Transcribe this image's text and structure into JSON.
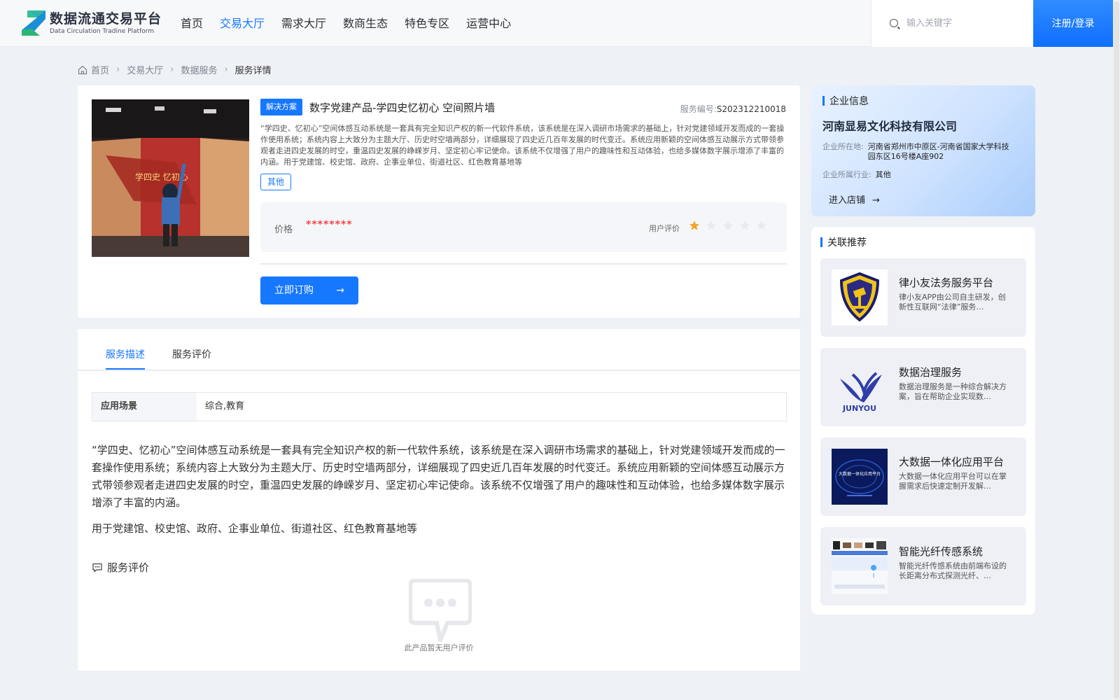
{
  "header": {
    "logo_title": "数据流通交易平台",
    "logo_subtitle": "Data Circulation Tradine Platform",
    "nav": [
      "首页",
      "交易大厅",
      "需求大厅",
      "数商生态",
      "特色专区",
      "运营中心"
    ],
    "nav_active_index": 1,
    "search_placeholder": "输入关键字",
    "login_label": "注册/登录"
  },
  "breadcrumb": [
    "首页",
    "交易大厅",
    "数据服务",
    "服务详情"
  ],
  "product": {
    "badge": "解决方案",
    "title": "数字党建产品-学四史忆初心 空间照片墙",
    "service_no_label": "服务编号:",
    "service_no": "S202312210018",
    "description": "“学四史、忆初心”空间体感互动系统是一套具有完全知识产权的新一代软件系统，该系统是在深入调研市场需求的基础上，针对党建领域开发而成的一套操作使用系统；系统内容上大致分为主题大厅、历史时空墙两部分，详细展现了四史近几百年发展的时代变迁。系统应用新颖的空间体感互动展示方式带领参观者走进四史发展的时空，重温四史发展的峥嵘岁月、坚定初心牢记使命。该系统不仅增强了用户的趣味性和互动体验，也给多媒体数字展示增添了丰富的内涵。用于党建馆、校史馆、政府、企事业单位、街道社区、红色教育基地等",
    "tag": "其他",
    "price_label": "价格",
    "price_value": "********",
    "rating_label": "用户评价",
    "rating": 1,
    "rating_max": 5,
    "order_label": "立即订购",
    "image_text": "学四史 忆初心"
  },
  "tabs": {
    "items": [
      "服务描述",
      "服务评价"
    ],
    "active_index": 0
  },
  "detail": {
    "scene_label": "应用场景",
    "scene_value": "综合,教育",
    "paragraph1": "“学四史、忆初心”空间体感互动系统是一套具有完全知识产权的新一代软件系统，该系统是在深入调研市场需求的基础上，针对党建领域开发而成的一套操作使用系统；系统内容上大致分为主题大厅、历史时空墙两部分，详细展现了四史近几百年发展的时代变迁。系统应用新颖的空间体感互动展示方式带领参观者走进四史发展的时空，重温四史发展的峥嵘岁月、坚定初心牢记使命。该系统不仅增强了用户的趣味性和互动体验，也给多媒体数字展示增添了丰富的内涵。",
    "paragraph2": "用于党建馆、校史馆、政府、企事业单位、街道社区、红色教育基地等",
    "review_title": "服务评价",
    "empty_text": "此产品暂无用户评价"
  },
  "company": {
    "section_title": "企业信息",
    "name": "河南显易文化科技有限公司",
    "location_label": "企业所在地:",
    "location": "河南省郑州市中原区-河南省国家大学科技园东区16号楼A座902",
    "industry_label": "企业所属行业:",
    "industry": "其他",
    "enter_shop": "进入店铺"
  },
  "recommend": {
    "section_title": "关联推荐",
    "items": [
      {
        "title": "律小友法务服务平台",
        "desc": "律小友APP由公司自主研发，创新性互联网“法律”服务…"
      },
      {
        "title": "数据治理服务",
        "desc": "数据治理服务是一种综合解决方案，旨在帮助企业实现数…",
        "logo_text": "JUNYOU"
      },
      {
        "title": "大数据一体化应用平台",
        "desc": "大数据一体化应用平台可以在掌握需求后快速定制开发解…",
        "image_text": "大数据一体化应用平台"
      },
      {
        "title": "智能光纤传感系统",
        "desc": "智能光纤传感系统由前端布设的长距离分布式探测光纤、…"
      }
    ]
  },
  "colors": {
    "primary": "#1677ff",
    "price": "#f0454b",
    "star_active": "#f5a623",
    "star_inactive": "#e8eaee"
  }
}
